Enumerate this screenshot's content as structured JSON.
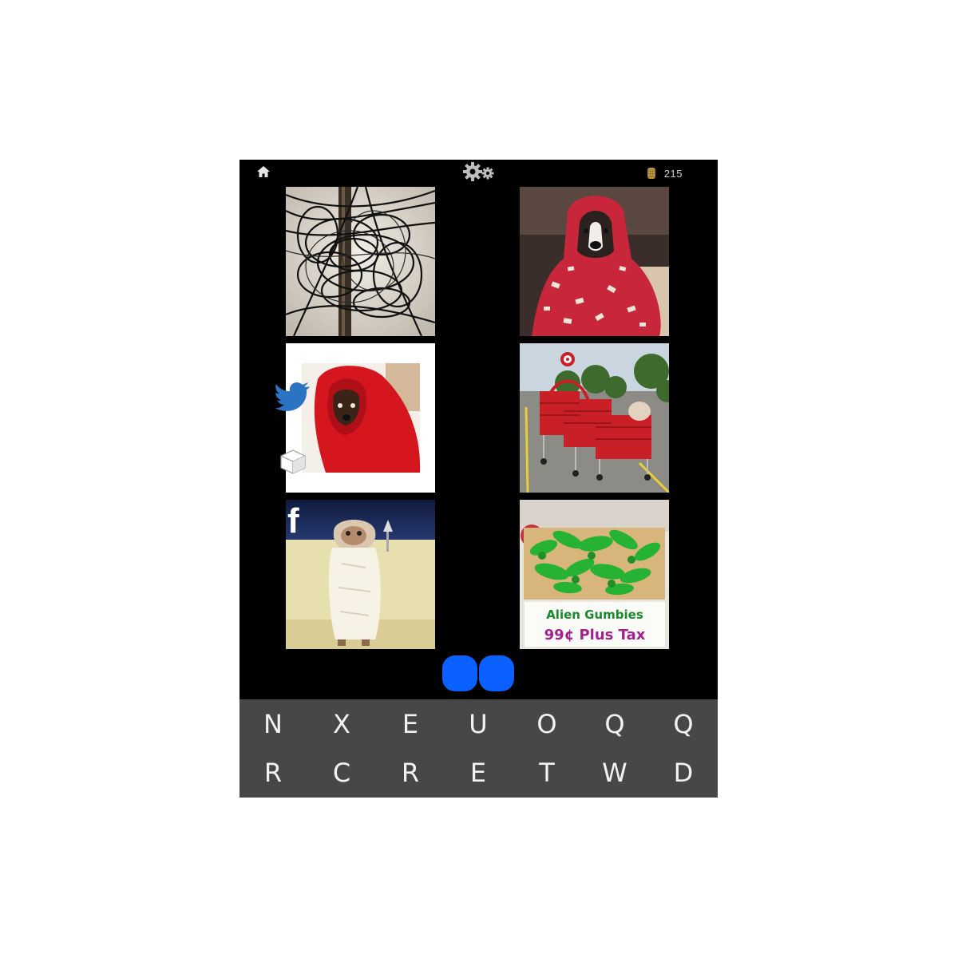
{
  "header": {
    "home_icon": "home-icon",
    "settings_icon": "gear-icon",
    "coin_icon": "coin-stack-icon",
    "coins": "215"
  },
  "tiles": [
    {
      "subject": "tangled power cables on pole"
    },
    {
      "subject": "dog wrapped in red blanket"
    },
    {
      "subject": "small dog in red blanket"
    },
    {
      "subject": "red shopping carts in parking lot"
    },
    {
      "subject": "E.T. figure wrapped in white blanket"
    },
    {
      "subject": "box of green alien toys",
      "sign_line1": "Alien Gumbies",
      "sign_line2": "99¢ Plus Tax"
    }
  ],
  "share": {
    "twitter_icon": "twitter-bird-icon",
    "hint_icon": "cube-icon",
    "facebook_icon": "facebook-icon",
    "facebook_glyph": "f"
  },
  "answer_slots": 2,
  "slot_color": "#0a61ff",
  "keyboard": {
    "row1": [
      "N",
      "X",
      "E",
      "U",
      "O",
      "Q",
      "Q"
    ],
    "row2": [
      "R",
      "C",
      "R",
      "E",
      "T",
      "W",
      "D"
    ]
  }
}
